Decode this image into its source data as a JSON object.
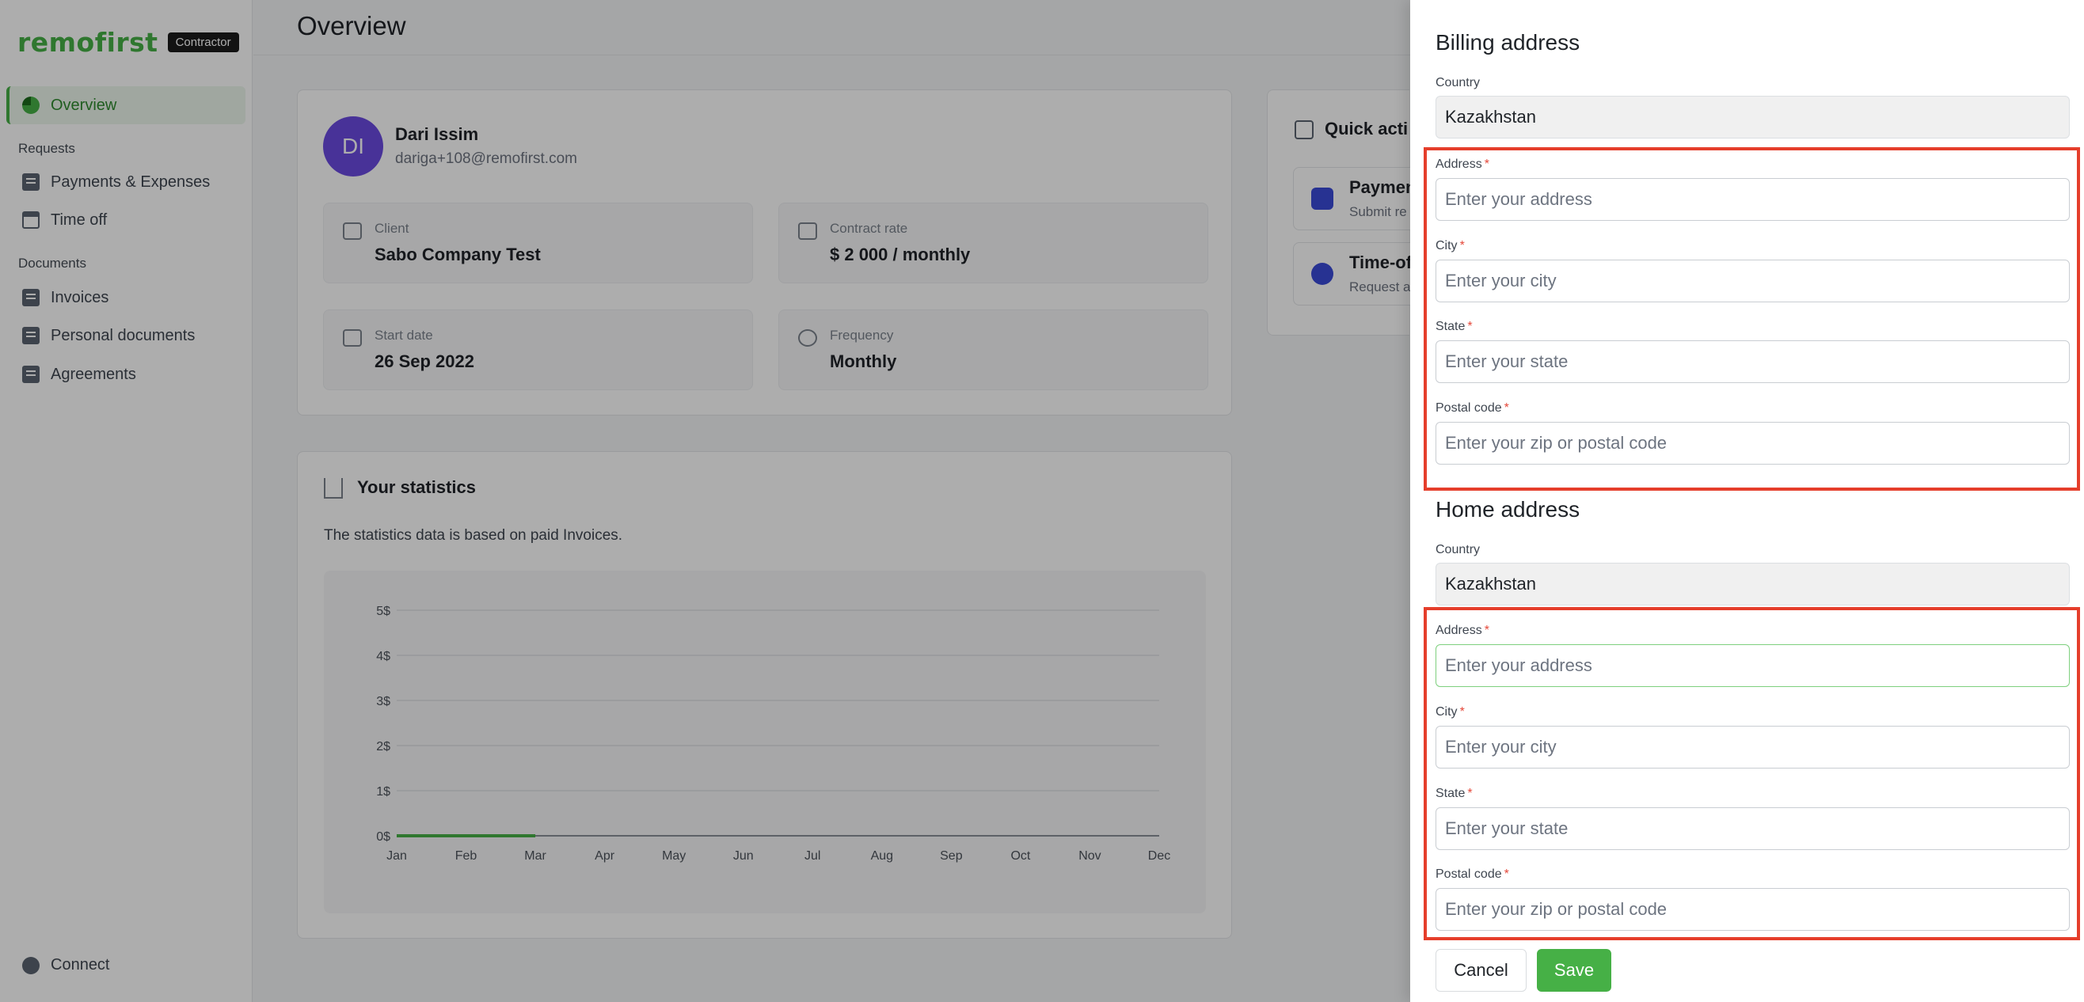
{
  "brand": {
    "logo": "remofirst",
    "tag": "Contractor"
  },
  "sidebar": {
    "overview": "Overview",
    "requests_heading": "Requests",
    "payments": "Payments & Expenses",
    "time_off": "Time off",
    "documents_heading": "Documents",
    "invoices": "Invoices",
    "personal_documents": "Personal documents",
    "agreements": "Agreements",
    "connect": "Connect"
  },
  "page": {
    "title": "Overview"
  },
  "profile": {
    "initials": "DI",
    "name": "Dari Issim",
    "email": "dariga+108@remofirst.com",
    "client_label": "Client",
    "client_value": "Sabo Company Test",
    "rate_label": "Contract rate",
    "rate_value": "$ 2 000 / monthly",
    "start_label": "Start date",
    "start_value": "26 Sep 2022",
    "frequency_label": "Frequency",
    "frequency_value": "Monthly"
  },
  "quick_actions": {
    "title": "Quick acti",
    "items": [
      {
        "title": "Paymen",
        "subtitle": "Submit re"
      },
      {
        "title": "Time-of",
        "subtitle": "Request a"
      }
    ]
  },
  "statistics": {
    "title": "Your statistics",
    "description": "The statistics data is based on paid Invoices."
  },
  "chart_data": {
    "type": "line",
    "categories": [
      "Jan",
      "Feb",
      "Mar",
      "Apr",
      "May",
      "Jun",
      "Jul",
      "Aug",
      "Sep",
      "Oct",
      "Nov",
      "Dec"
    ],
    "series": [
      {
        "values": [
          0,
          0,
          0,
          null,
          null,
          null,
          null,
          null,
          null,
          null,
          null,
          null
        ],
        "color": "#46b046"
      }
    ],
    "y_ticks": [
      "0$",
      "1$",
      "2$",
      "3$",
      "4$",
      "5$"
    ],
    "ylim": [
      0,
      5
    ],
    "grid": true
  },
  "drawer": {
    "billing_title": "Billing address",
    "home_title": "Home address",
    "country_label": "Country",
    "country_value": "Kazakhstan",
    "address_label": "Address",
    "address_placeholder": "Enter your address",
    "city_label": "City",
    "city_placeholder": "Enter your city",
    "state_label": "State",
    "state_placeholder": "Enter your state",
    "postal_label": "Postal code",
    "postal_placeholder": "Enter your zip or postal code",
    "required_mark": "*",
    "cancel": "Cancel",
    "save": "Save"
  },
  "colors": {
    "brand_green": "#46b046",
    "highlight_red": "#e53e2b",
    "avatar_purple": "#6b4be0"
  }
}
